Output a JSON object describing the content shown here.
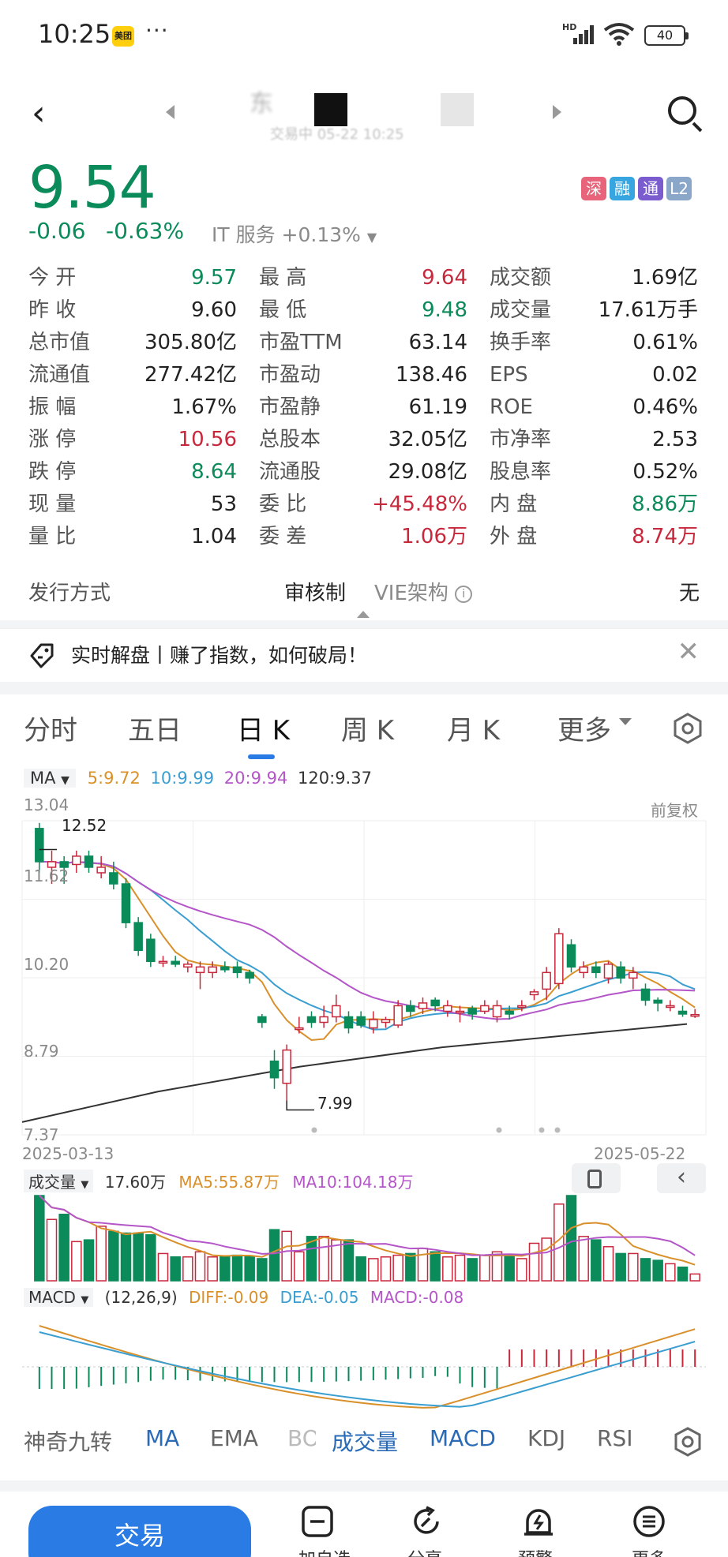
{
  "status_bar": {
    "time": "10:25",
    "app_badge": "美团",
    "more": "···",
    "network": "HD",
    "battery": "40"
  },
  "header": {
    "stock_name": "东",
    "sub": "交易中 05-22 10:25"
  },
  "quote": {
    "price": "9.54",
    "change": "-0.06",
    "change_pct": "-0.63%",
    "sector": "IT 服务 +0.13%",
    "tags": [
      {
        "label": "深",
        "color": "#e8647a"
      },
      {
        "label": "融",
        "color": "#37a6e0"
      },
      {
        "label": "通",
        "color": "#7a5ccf"
      },
      {
        "label": "L2",
        "color": "#8aa6c8"
      }
    ],
    "rows": [
      [
        {
          "l": "今 开",
          "v": "9.57",
          "c": "green"
        },
        {
          "l": "最 高",
          "v": "9.64",
          "c": "red"
        },
        {
          "l": "成交额",
          "v": "1.69亿",
          "c": ""
        }
      ],
      [
        {
          "l": "昨 收",
          "v": "9.60",
          "c": ""
        },
        {
          "l": "最 低",
          "v": "9.48",
          "c": "green"
        },
        {
          "l": "成交量",
          "v": "17.61万手",
          "c": ""
        }
      ],
      [
        {
          "l": "总市值",
          "v": "305.80亿",
          "c": ""
        },
        {
          "l": "市盈TTM",
          "v": "63.14",
          "c": ""
        },
        {
          "l": "换手率",
          "v": "0.61%",
          "c": ""
        }
      ],
      [
        {
          "l": "流通值",
          "v": "277.42亿",
          "c": ""
        },
        {
          "l": "市盈动",
          "v": "138.46",
          "c": ""
        },
        {
          "l": "EPS",
          "v": "0.02",
          "c": ""
        }
      ],
      [
        {
          "l": "振 幅",
          "v": "1.67%",
          "c": ""
        },
        {
          "l": "市盈静",
          "v": "61.19",
          "c": ""
        },
        {
          "l": "ROE",
          "v": "0.46%",
          "c": ""
        }
      ],
      [
        {
          "l": "涨 停",
          "v": "10.56",
          "c": "red"
        },
        {
          "l": "总股本",
          "v": "32.05亿",
          "c": ""
        },
        {
          "l": "市净率",
          "v": "2.53",
          "c": ""
        }
      ],
      [
        {
          "l": "跌 停",
          "v": "8.64",
          "c": "green"
        },
        {
          "l": "流通股",
          "v": "29.08亿",
          "c": ""
        },
        {
          "l": "股息率",
          "v": "0.52%",
          "c": ""
        }
      ],
      [
        {
          "l": "现 量",
          "v": "53",
          "c": ""
        },
        {
          "l": "委 比",
          "v": "+45.48%",
          "c": "red"
        },
        {
          "l": "内 盘",
          "v": "8.86万",
          "c": "green"
        }
      ],
      [
        {
          "l": "量 比",
          "v": "1.04",
          "c": ""
        },
        {
          "l": "委 差",
          "v": "1.06万",
          "c": "red"
        },
        {
          "l": "外 盘",
          "v": "8.74万",
          "c": "red"
        }
      ]
    ],
    "issue": {
      "label": "发行方式",
      "value": "审核制",
      "vie_label": "VIE架构",
      "vie_value": "无"
    }
  },
  "banner": {
    "text": "实时解盘丨赚了指数，如何破局！"
  },
  "tabs": [
    "分时",
    "五日",
    "日 K",
    "周 K",
    "月 K",
    "更多"
  ],
  "active_tab": "日 K",
  "ma": {
    "label": "MA",
    "ma5": "5:9.72",
    "ma10": "10:9.99",
    "ma20": "20:9.94",
    "ma120": "120:9.37"
  },
  "chart_info": {
    "adjust": "前复权",
    "high_label": "12.52",
    "low_label": "7.99",
    "date_start": "2025-03-13",
    "date_end": "2025-05-22",
    "y_ticks": [
      "13.04",
      "11.62",
      "10.20",
      "8.79",
      "7.37"
    ]
  },
  "volume": {
    "label": "成交量",
    "value": "17.60万",
    "ma5": "MA5:55.87万",
    "ma10": "MA10:104.18万"
  },
  "macd": {
    "label": "MACD",
    "params": "(12,26,9)",
    "diff": "DIFF:-0.09",
    "dea": "DEA:-0.05",
    "macd": "MACD:-0.08"
  },
  "indicators": [
    "神奇九转",
    "MA",
    "EMA",
    "BO",
    "成交量",
    "MACD",
    "KDJ",
    "RSI"
  ],
  "bottom_nav": {
    "trade": "交易",
    "items": [
      "加自选",
      "分享",
      "预警",
      "更多"
    ]
  },
  "colors": {
    "up": "#c8283c",
    "down": "#0b8a5a",
    "accent": "#2a7be4",
    "ma5": "#d9902a",
    "ma10": "#3a9ed0",
    "ma20": "#b455c8",
    "ma120": "#333333"
  },
  "chart_data": {
    "type": "candlestick",
    "y_range": [
      7.37,
      13.04
    ],
    "candles": [
      [
        12.9,
        12.3,
        13.0,
        12.1
      ],
      [
        12.2,
        12.3,
        12.5,
        11.9
      ],
      [
        12.3,
        12.2,
        12.4,
        11.9
      ],
      [
        12.25,
        12.4,
        12.5,
        12.1
      ],
      [
        12.4,
        12.2,
        12.5,
        12.1
      ],
      [
        12.1,
        12.2,
        12.4,
        12.0
      ],
      [
        12.1,
        11.9,
        12.3,
        11.8
      ],
      [
        11.9,
        11.2,
        12.0,
        11.1
      ],
      [
        11.2,
        10.7,
        11.3,
        10.6
      ],
      [
        10.9,
        10.5,
        11.0,
        10.4
      ],
      [
        10.5,
        10.5,
        10.6,
        10.4
      ],
      [
        10.5,
        10.45,
        10.6,
        10.4
      ],
      [
        10.4,
        10.45,
        10.5,
        10.3
      ],
      [
        10.3,
        10.4,
        10.5,
        10.0
      ],
      [
        10.3,
        10.4,
        10.5,
        10.2
      ],
      [
        10.4,
        10.35,
        10.5,
        10.3
      ],
      [
        10.4,
        10.3,
        10.5,
        10.2
      ],
      [
        10.3,
        10.2,
        10.35,
        10.1
      ],
      [
        9.5,
        9.4,
        9.55,
        9.3
      ],
      [
        8.7,
        8.4,
        8.9,
        8.2
      ],
      [
        8.3,
        8.9,
        9.0,
        7.99
      ],
      [
        9.3,
        9.3,
        9.5,
        9.2
      ],
      [
        9.5,
        9.4,
        9.6,
        9.3
      ],
      [
        9.4,
        9.5,
        9.7,
        9.3
      ],
      [
        9.5,
        9.7,
        9.9,
        9.4
      ],
      [
        9.5,
        9.3,
        9.6,
        9.2
      ],
      [
        9.5,
        9.35,
        9.6,
        9.3
      ],
      [
        9.3,
        9.45,
        9.6,
        9.2
      ],
      [
        9.4,
        9.45,
        9.5,
        9.3
      ],
      [
        9.35,
        9.7,
        9.8,
        9.3
      ],
      [
        9.7,
        9.6,
        9.8,
        9.5
      ],
      [
        9.65,
        9.75,
        9.85,
        9.55
      ],
      [
        9.8,
        9.7,
        9.85,
        9.6
      ],
      [
        9.6,
        9.7,
        9.8,
        9.5
      ],
      [
        9.6,
        9.6,
        9.7,
        9.4
      ],
      [
        9.65,
        9.55,
        9.7,
        9.45
      ],
      [
        9.6,
        9.7,
        9.8,
        9.55
      ],
      [
        9.5,
        9.7,
        9.8,
        9.4
      ],
      [
        9.6,
        9.55,
        9.7,
        9.45
      ],
      [
        9.7,
        9.7,
        9.8,
        9.6
      ],
      [
        9.9,
        9.95,
        10.0,
        9.8
      ],
      [
        10.0,
        10.3,
        10.4,
        9.8
      ],
      [
        10.1,
        11.0,
        11.1,
        10.0
      ],
      [
        10.8,
        10.4,
        10.9,
        10.3
      ],
      [
        10.3,
        10.4,
        10.5,
        10.2
      ],
      [
        10.4,
        10.3,
        10.5,
        10.2
      ],
      [
        10.2,
        10.45,
        10.5,
        10.1
      ],
      [
        10.4,
        10.2,
        10.5,
        10.1
      ],
      [
        10.2,
        10.3,
        10.4,
        10.0
      ],
      [
        10.0,
        9.8,
        10.1,
        9.7
      ],
      [
        9.8,
        9.75,
        9.85,
        9.6
      ],
      [
        9.7,
        9.7,
        9.8,
        9.6
      ],
      [
        9.6,
        9.55,
        9.7,
        9.5
      ],
      [
        9.54,
        9.54,
        9.64,
        9.48
      ]
    ],
    "volumes": [
      100,
      72,
      78,
      46,
      48,
      64,
      58,
      56,
      56,
      54,
      32,
      28,
      28,
      34,
      28,
      28,
      30,
      28,
      26,
      60,
      58,
      34,
      52,
      52,
      48,
      48,
      28,
      26,
      28,
      30,
      32,
      38,
      34,
      28,
      30,
      26,
      30,
      34,
      30,
      26,
      44,
      50,
      90,
      100,
      52,
      48,
      40,
      32,
      32,
      26,
      24,
      20,
      16,
      8
    ]
  }
}
